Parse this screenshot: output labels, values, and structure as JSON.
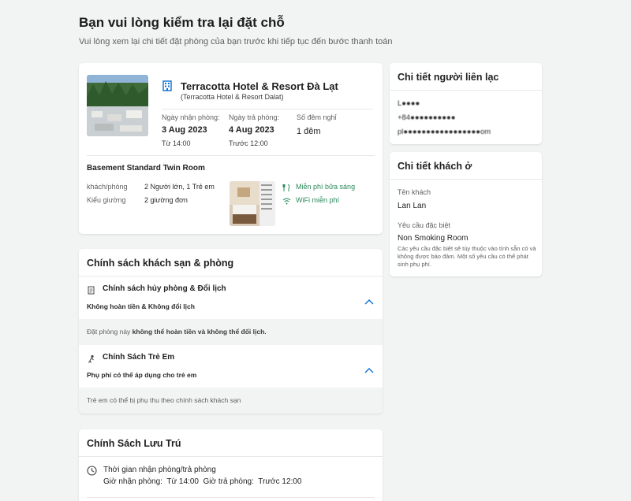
{
  "page": {
    "title": "Bạn vui lòng kiểm tra lại đặt chỗ",
    "subtitle": "Vui lòng xem lại chi tiết đặt phòng của bạn trước khi tiếp tục đến bước thanh toán"
  },
  "hotel": {
    "name": "Terracotta Hotel & Resort Đà Lạt",
    "subname": "(Terracotta Hotel & Resort Dalat)",
    "checkin_label": "Ngày nhận phòng:",
    "checkin_date": "3 Aug 2023",
    "checkin_time": "Từ 14:00",
    "checkout_label": "Ngày trả phòng:",
    "checkout_date": "4 Aug 2023",
    "checkout_time": "Trước 12:00",
    "nights_label": "Số đêm nghỉ",
    "nights_value": "1 đêm",
    "room_name": "Basement Standard Twin Room",
    "guests_label": "khách/phòng",
    "guests_value": "2 Người lớn, 1 Trẻ em",
    "bed_label": "Kiểu giường",
    "bed_value": "2 giường đơn",
    "amenities": [
      "Miễn phí bữa sáng",
      "WiFi miễn phí"
    ]
  },
  "contact": {
    "title": "Chi tiết người liên lạc",
    "name": "L●●●●",
    "phone": "+84●●●●●●●●●●",
    "email": "pl●●●●●●●●●●●●●●●●●om"
  },
  "guest": {
    "title": "Chi tiết khách ở",
    "name_label": "Tên khách",
    "name_value": "Lan Lan",
    "request_label": "Yêu cầu đặc biệt",
    "request_value": "Non Smoking Room",
    "request_note": "Các yêu cầu đặc biệt sẽ tùy thuộc vào tình sẵn có và không được bảo đảm. Một số yêu cầu có thể phát sinh phụ phí."
  },
  "policy": {
    "title": "Chính sách khách sạn & phòng",
    "cancel_title": "Chính sách hủy phòng & Đổi lịch",
    "cancel_sub": "Không hoàn tiền & Không đổi lịch",
    "cancel_detail_pre": "Đặt phòng này ",
    "cancel_detail_bold": "không thể hoàn tiền và không thể đổi lịch.",
    "child_title": "Chính Sách Trẻ Em",
    "child_sub": "Phụ phí có thể áp dụng cho trẻ em",
    "child_detail": "Trẻ em có thể bị phụ thu theo chính sách khách sạn"
  },
  "stay": {
    "title": "Chính Sách Lưu Trú",
    "item_title": "Thời gian nhận phòng/trả phòng",
    "checkin_label": "Giờ nhận phòng:",
    "checkin_value": "Từ 14:00",
    "checkout_label": "Giờ trả phòng:",
    "checkout_value": "Trước 12:00"
  },
  "colors": {
    "accent": "#0b6fd3",
    "green": "#2b8a5a",
    "background": "#f2f3f3"
  }
}
